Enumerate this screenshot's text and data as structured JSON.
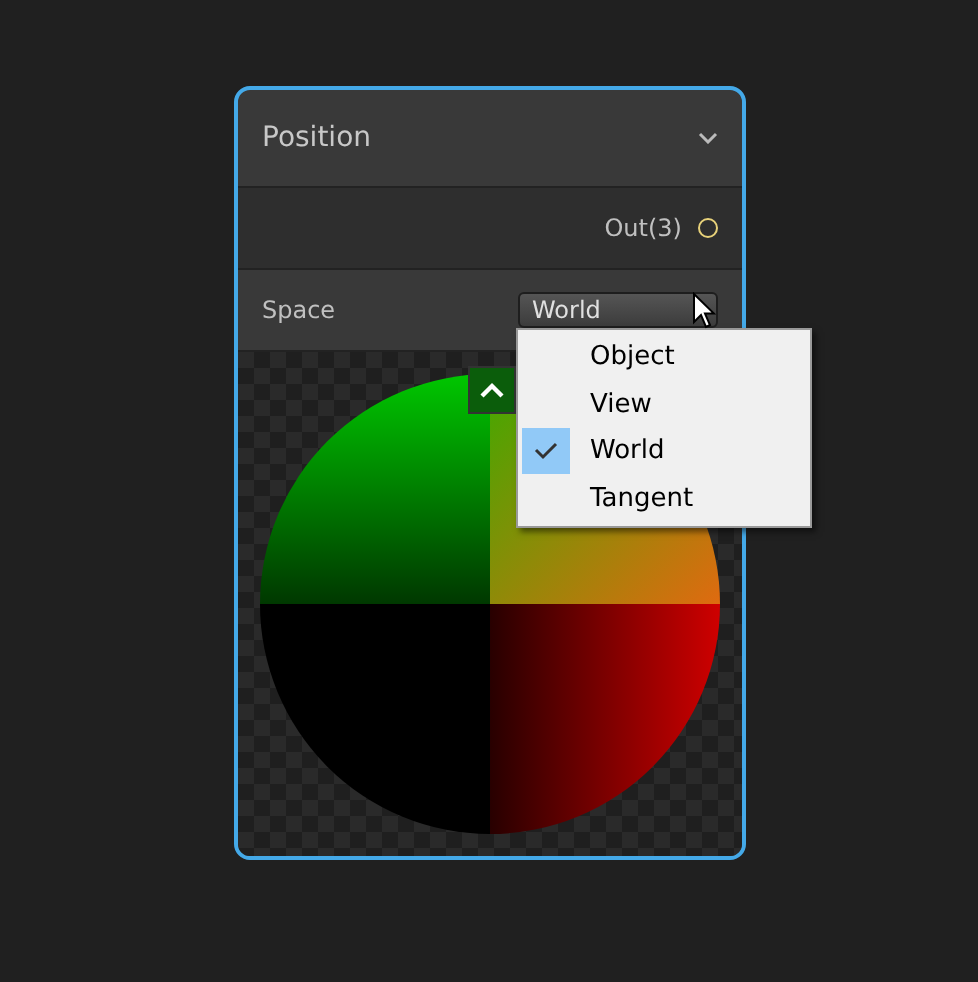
{
  "node": {
    "title": "Position",
    "selected": true,
    "expanded": true
  },
  "outputs": [
    {
      "label": "Out(3)"
    }
  ],
  "property": {
    "label": "Space",
    "value": "World"
  },
  "menu": [
    {
      "label": "Object",
      "selected": false
    },
    {
      "label": "View",
      "selected": false
    },
    {
      "label": "World",
      "selected": true
    },
    {
      "label": "Tangent",
      "selected": false
    }
  ],
  "preview": {
    "expanded": true
  }
}
